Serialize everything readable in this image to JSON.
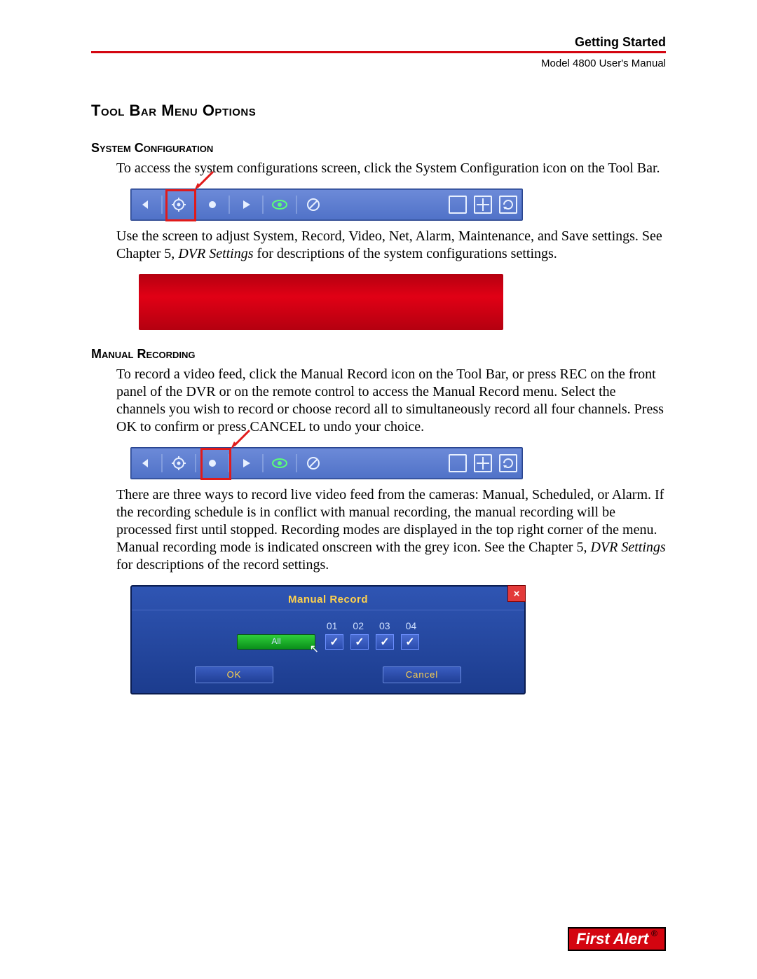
{
  "header": {
    "section": "Getting Started",
    "subtitle": "Model 4800 User's Manual"
  },
  "h1": "Tool Bar Menu Options",
  "sysconf": {
    "heading": "System Configuration",
    "p1": "To access the system configurations screen, click the System Configuration icon on the Tool Bar.",
    "p2_a": "Use the screen to adjust System, Record, Video, Net, Alarm, Maintenance, and Save settings. See Chapter 5, ",
    "p2_em": "DVR Settings",
    "p2_b": " for descriptions of the system configurations settings."
  },
  "manrec": {
    "heading": "Manual Recording",
    "p1": "To record a video feed, click the Manual Record icon on the Tool Bar, or press REC on the front panel of the DVR or on the remote control to access the Manual Record menu. Select the channels you wish to record or choose record all to simultaneously record all four channels. Press OK to confirm or press CANCEL to undo your choice.",
    "p2_a": "There are three ways to record live video feed from the cameras: Manual, Scheduled, or Alarm. If the recording schedule is in conflict with manual recording, the manual recording will be processed first until stopped. Recording modes are displayed in the top right corner of the menu. Manual recording mode is indicated onscreen with the grey icon. See the Chapter 5, ",
    "p2_em": "DVR Settings",
    "p2_b": " for descriptions of the record settings."
  },
  "dialog": {
    "title": "Manual Record",
    "channels": [
      "01",
      "02",
      "03",
      "04"
    ],
    "all": "All",
    "ok": "OK",
    "cancel": "Cancel",
    "close": "×"
  },
  "toolbar_icons": {
    "left": "left-arrow-icon",
    "gear": "gear-icon",
    "record": "record-dot-icon",
    "play": "play-icon",
    "eye": "eye-icon",
    "compass": "compass-icon",
    "single": "single-view-icon",
    "quad": "quad-view-icon",
    "rotate": "rotate-view-icon"
  },
  "brand": "First Alert",
  "registered": "®"
}
